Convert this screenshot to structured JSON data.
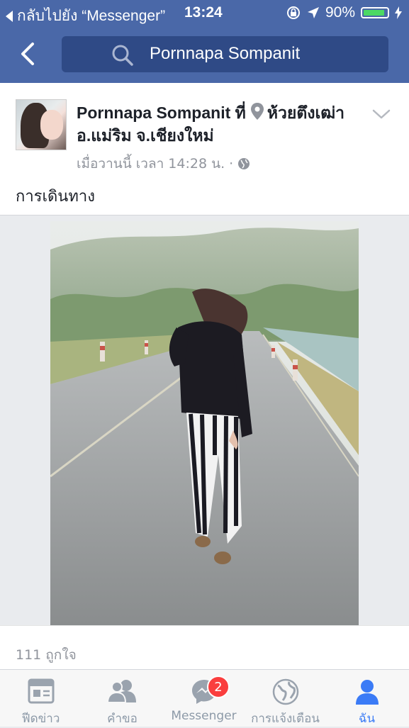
{
  "status_bar": {
    "back_to_app": "กลับไปยัง “Messenger”",
    "time": "13:24",
    "battery_percent": "90%",
    "battery_level": 0.9
  },
  "nav": {
    "search_text": "Pornnapa Sompanit"
  },
  "post": {
    "author": "Pornnapa Sompanit",
    "at_word": "ที่",
    "location": "ห้วยตึงเฒ่า อ.แม่ริม จ.เชียงใหม่",
    "timestamp": "เมื่อวานนี้ เวลา 14:28 น.",
    "dot": "·",
    "caption": "การเดินทาง",
    "likes_text": "111 ถูกใจ"
  },
  "tabs": [
    {
      "label": "ฟีดข่าว",
      "icon": "news-feed-icon"
    },
    {
      "label": "คำขอ",
      "icon": "friend-requests-icon"
    },
    {
      "label": "Messenger",
      "icon": "messenger-icon",
      "badge": "2"
    },
    {
      "label": "การแจ้งเตือน",
      "icon": "globe-notifications-icon"
    },
    {
      "label": "ฉัน",
      "icon": "profile-icon",
      "active": true
    }
  ],
  "colors": {
    "nav_blue": "#4a68a8",
    "search_bg": "#2f4a86",
    "active_tab": "#3b7bf6",
    "badge_red": "#fa3e3e"
  }
}
